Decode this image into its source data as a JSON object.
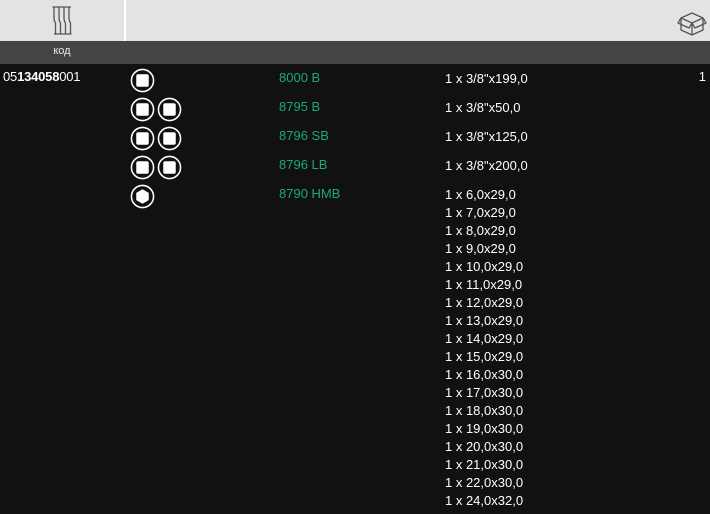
{
  "header": {
    "code_icon": "tool-set-icon",
    "box_icon": "package-box-icon",
    "column_label": "код"
  },
  "article": {
    "prefix": "05",
    "bold": "134058",
    "suffix": "001"
  },
  "quantity": "1",
  "colors": {
    "topbar": "#e3e3e3",
    "subbar": "#444444",
    "background": "#111111",
    "model_text": "#1aa77c",
    "text": "#ffffff"
  },
  "rows": [
    {
      "icons": [
        "square-drive-icon"
      ],
      "model": "8000 B",
      "specs": [
        "1 x 3/8\"x199,0"
      ]
    },
    {
      "icons": [
        "square-drive-icon",
        "square-drive-icon"
      ],
      "model": "8795 B",
      "specs": [
        "1 x 3/8\"x50,0"
      ]
    },
    {
      "icons": [
        "square-drive-icon",
        "square-drive-icon"
      ],
      "model": "8796 SB",
      "specs": [
        "1 x 3/8\"x125,0"
      ]
    },
    {
      "icons": [
        "square-drive-icon",
        "square-drive-icon"
      ],
      "model": "8796 LB",
      "specs": [
        "1 x 3/8\"x200,0"
      ]
    },
    {
      "icons": [
        "hex-drive-icon"
      ],
      "model": "8790 HMB",
      "specs": [
        "1 x 6,0x29,0",
        "1 x 7,0x29,0",
        "1 x 8,0x29,0",
        "1 x 9,0x29,0",
        "1 x 10,0x29,0",
        "1 x 11,0x29,0",
        "1 x 12,0x29,0",
        "1 x 13,0x29,0",
        "1 x 14,0x29,0",
        "1 x 15,0x29,0",
        "1 x 16,0x30,0",
        "1 x 17,0x30,0",
        "1 x 18,0x30,0",
        "1 x 19,0x30,0",
        "1 x 20,0x30,0",
        "1 x 21,0x30,0",
        "1 x 22,0x30,0",
        "1 x 24,0x32,0"
      ]
    }
  ]
}
